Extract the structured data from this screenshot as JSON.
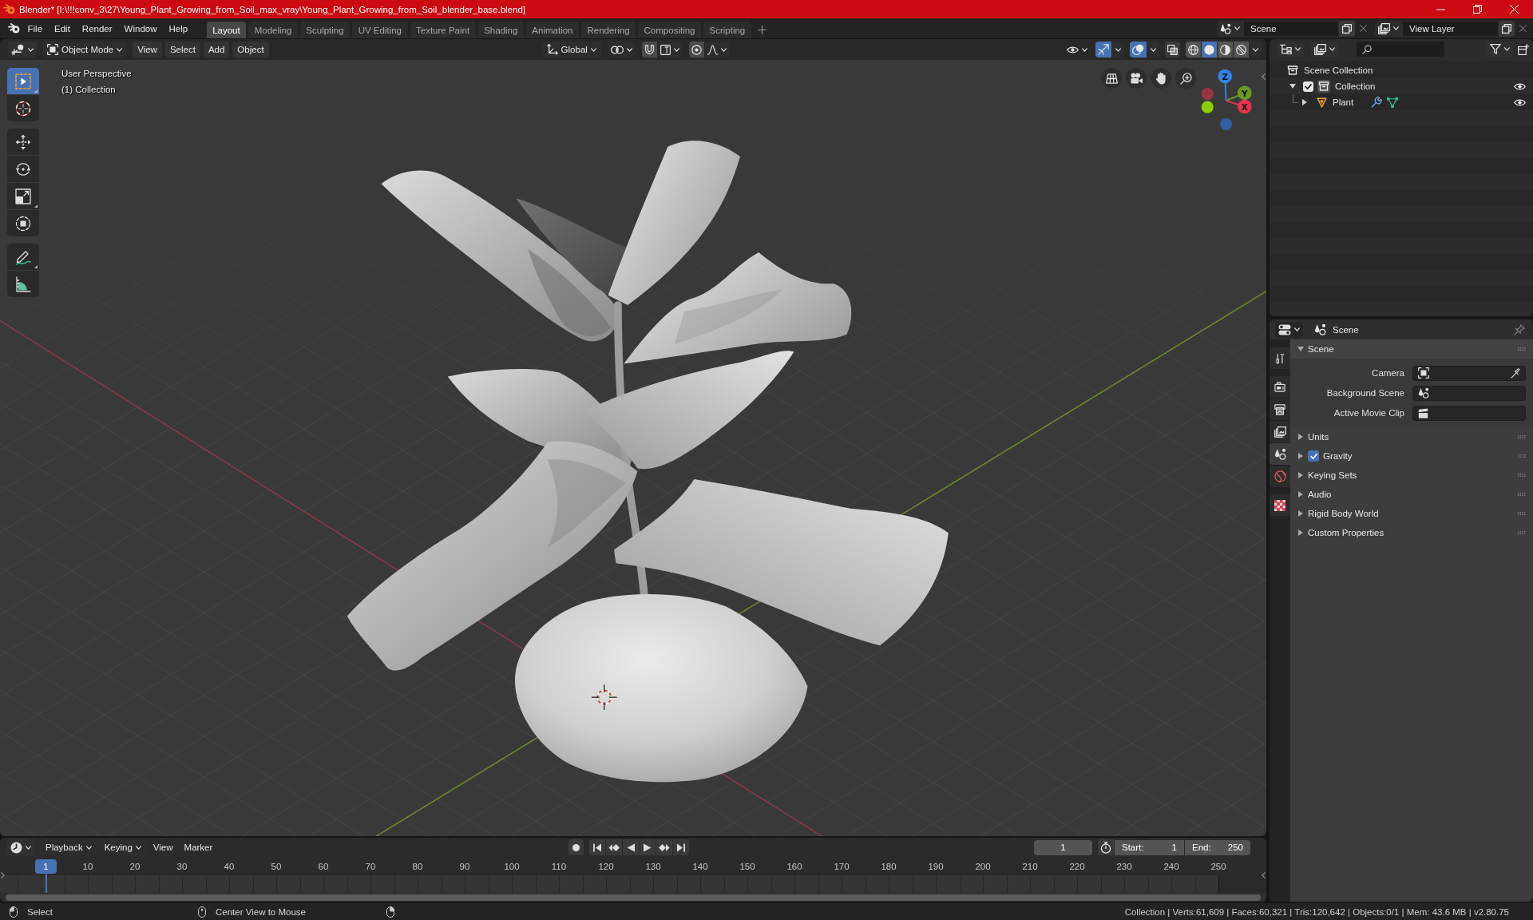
{
  "window": {
    "title": "Blender* [I:\\!!!conv_3\\27\\Young_Plant_Growing_from_Soil_max_vray\\Young_Plant_Growing_from_Soil_blender_base.blend]"
  },
  "menu_bar": {
    "menus": [
      "File",
      "Edit",
      "Render",
      "Window",
      "Help"
    ],
    "workspaces": [
      {
        "label": "Layout",
        "selected": true
      },
      {
        "label": "Modeling",
        "selected": false
      },
      {
        "label": "Sculpting",
        "selected": false
      },
      {
        "label": "UV Editing",
        "selected": false
      },
      {
        "label": "Texture Paint",
        "selected": false
      },
      {
        "label": "Shading",
        "selected": false
      },
      {
        "label": "Animation",
        "selected": false
      },
      {
        "label": "Rendering",
        "selected": false
      },
      {
        "label": "Compositing",
        "selected": false
      },
      {
        "label": "Scripting",
        "selected": false
      }
    ],
    "scene": "Scene",
    "view_layer": "View Layer"
  },
  "viewport": {
    "header": {
      "mode": "Object Mode",
      "menus": [
        "View",
        "Select",
        "Add",
        "Object"
      ],
      "orientation": "Global",
      "gizmos_on": true,
      "overlays_on": true,
      "xray_on": false,
      "shading": [
        {
          "selected": false
        },
        {
          "selected": true
        },
        {
          "selected": false
        },
        {
          "selected": false
        }
      ]
    },
    "view_info": [
      "User Perspective",
      "(1) Collection"
    ],
    "tool_groups": [
      {
        "tools": [
          {
            "selected": true
          },
          {
            "selected": false
          }
        ]
      },
      {
        "tools": [
          {
            "selected": false
          },
          {
            "selected": false
          },
          {
            "selected": false
          },
          {
            "selected": false
          }
        ]
      },
      {
        "tools": [
          {
            "selected": false
          },
          {
            "selected": false
          }
        ]
      }
    ],
    "gizmo_axes": [
      "Z",
      "Y",
      "X"
    ]
  },
  "outliner": {
    "tree": [
      {
        "label": "Scene Collection",
        "kind": "scene_collection",
        "children": [
          {
            "label": "Collection",
            "kind": "collection",
            "expanded": true,
            "checked": true,
            "active": true,
            "visible": true,
            "children": [
              {
                "label": "Plant",
                "kind": "object",
                "expanded": false,
                "visible": true
              }
            ]
          }
        ]
      }
    ]
  },
  "properties": {
    "context": "Scene",
    "tab_groups": [
      {
        "tabs": [
          {
            "selected": false
          }
        ]
      },
      {
        "tabs": [
          {
            "selected": false
          },
          {
            "selected": false
          },
          {
            "selected": false
          },
          {
            "selected": true
          },
          {
            "selected": false
          }
        ]
      },
      {
        "tabs": [
          {
            "selected": false
          }
        ]
      }
    ],
    "panels": [
      {
        "title": "Scene",
        "expanded": true,
        "fields": [
          {
            "label": "Camera",
            "kind": "camera"
          },
          {
            "label": "Background Scene",
            "kind": "scene"
          },
          {
            "label": "Active Movie Clip",
            "kind": "movie_clip"
          }
        ]
      },
      {
        "title": "Units",
        "expanded": false
      },
      {
        "title": "Gravity",
        "expanded": false,
        "checked": true
      },
      {
        "title": "Keying Sets",
        "expanded": false
      },
      {
        "title": "Audio",
        "expanded": false
      },
      {
        "title": "Rigid Body World",
        "expanded": false
      },
      {
        "title": "Custom Properties",
        "expanded": false
      }
    ]
  },
  "timeline": {
    "menus": [
      {
        "label": "Playback",
        "kind": "dropdown"
      },
      {
        "label": "Keying",
        "kind": "dropdown"
      },
      {
        "label": "View",
        "kind": "menu"
      },
      {
        "label": "Marker",
        "kind": "menu"
      }
    ],
    "current_frame": "1",
    "start": {
      "label": "Start:",
      "value": "1"
    },
    "end": {
      "label": "End:",
      "value": "250"
    },
    "playhead": "1",
    "ruler": [
      "10",
      "20",
      "30",
      "40",
      "50",
      "60",
      "70",
      "80",
      "90",
      "100",
      "110",
      "120",
      "130",
      "140",
      "150",
      "160",
      "170",
      "180",
      "190",
      "200",
      "210",
      "220",
      "230",
      "240",
      "250"
    ]
  },
  "status_bar": {
    "hints": [
      "Select",
      "Center View to Mouse"
    ],
    "stats": "Collection | Verts:61,609 | Faces:60,321 | Tris:120,642 | Objects:0/1 | Mem: 43.6 MB | v2.80.75"
  }
}
